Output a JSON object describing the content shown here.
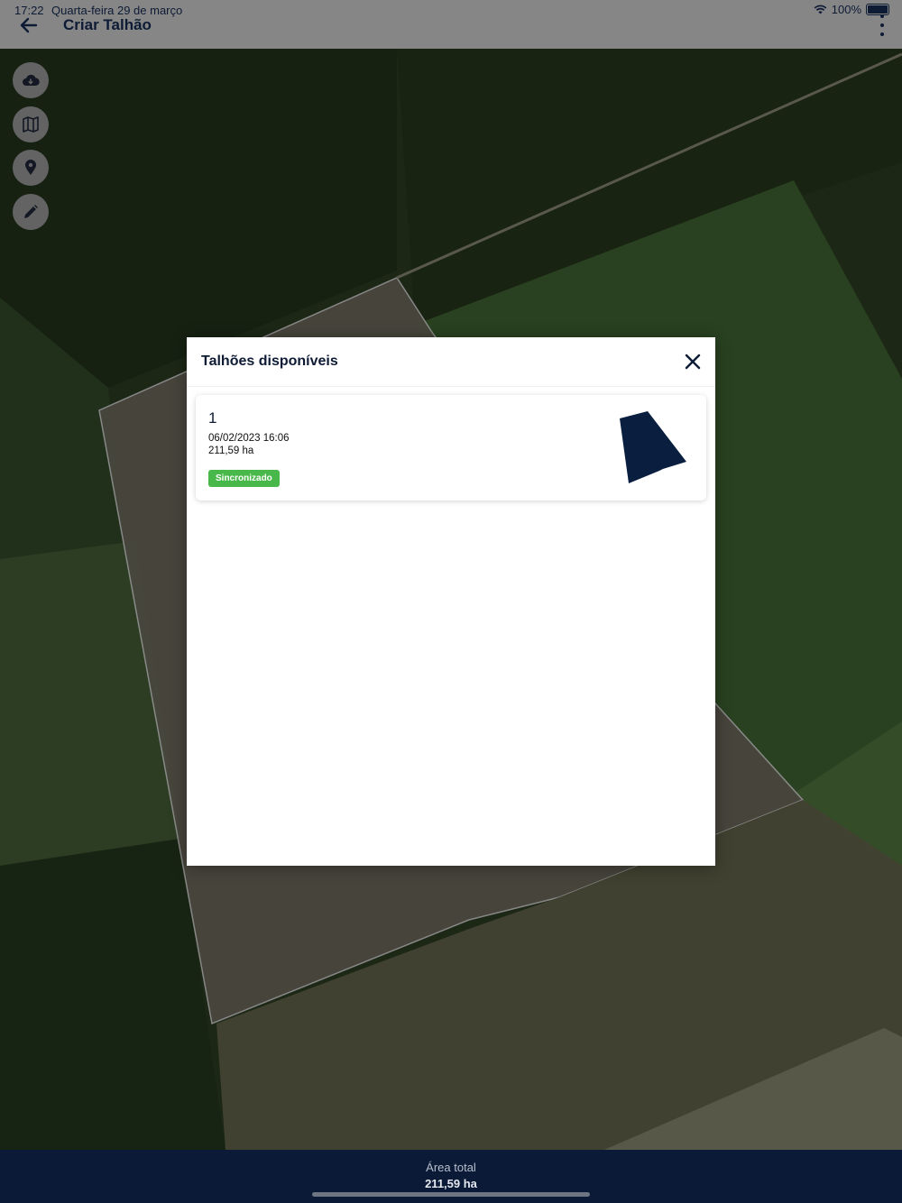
{
  "status_bar": {
    "time": "17:22",
    "date": "Quarta-feira 29 de março",
    "battery": "100%"
  },
  "header": {
    "title": "Criar Talhão"
  },
  "tools": [
    {
      "icon": "cloud-download-icon"
    },
    {
      "icon": "map-icon"
    },
    {
      "icon": "location-pin-icon"
    },
    {
      "icon": "pencil-icon"
    }
  ],
  "modal": {
    "title": "Talhões disponíveis",
    "items": [
      {
        "name": "1",
        "date": "06/02/2023 16:06",
        "area": "211,59 ha",
        "status": "Sincronizado"
      }
    ]
  },
  "footer": {
    "label": "Área total",
    "value": "211,59 ha"
  },
  "colors": {
    "primary": "#0a1a37",
    "success": "#49b84a",
    "header_bg": "#868686"
  }
}
